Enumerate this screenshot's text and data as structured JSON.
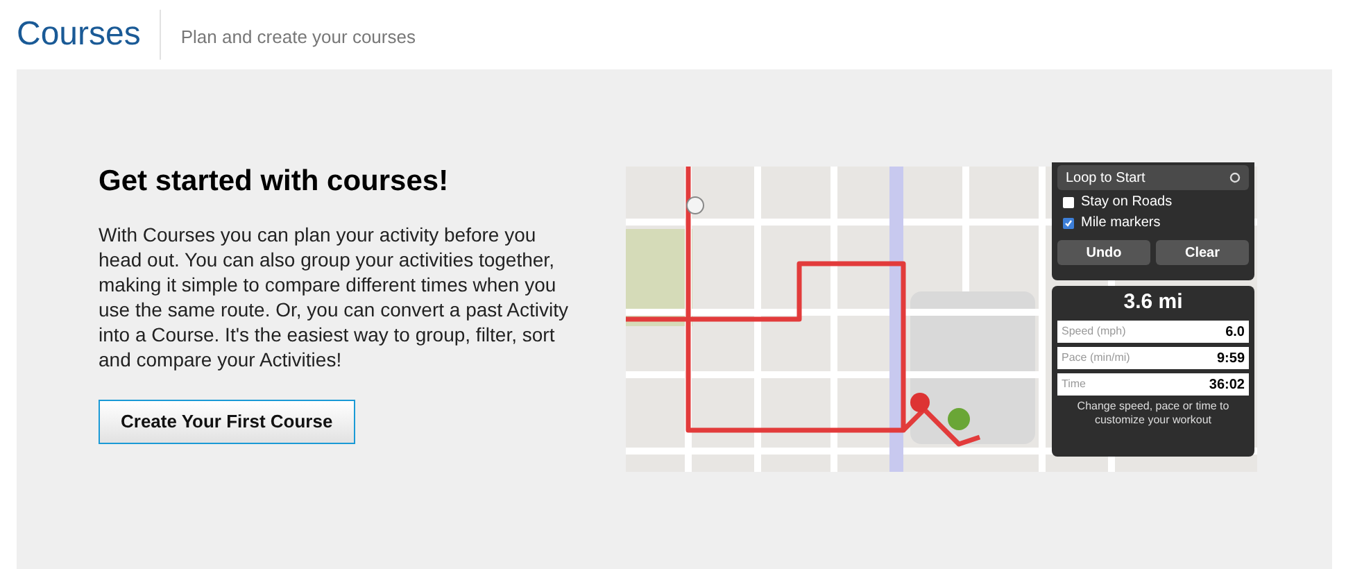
{
  "header": {
    "title": "Courses",
    "subtitle": "Plan and create your courses"
  },
  "intro": {
    "heading": "Get started with courses!",
    "body": "With Courses you can plan your activity before you head out. You can also group your activities together, making it simple to compare different times when you use the same route. Or, you can convert a past Activity into a Course. It's the easiest way to group, filter, sort and compare your Activities!",
    "button": "Create Your First Course"
  },
  "map_preview": {
    "panel": {
      "title": "Loop to Start",
      "options": [
        {
          "label": "Stay on Roads",
          "checked": false
        },
        {
          "label": "Mile markers",
          "checked": true
        }
      ],
      "buttons": [
        "Undo",
        "Clear"
      ],
      "distance": "3.6 mi",
      "fields": [
        {
          "label": "Speed (mph)",
          "value": "6.0"
        },
        {
          "label": "Pace (min/mi)",
          "value": "9:59"
        },
        {
          "label": "Time",
          "value": "36:02"
        }
      ],
      "hint": "Change speed, pace or time to customize your workout"
    }
  }
}
